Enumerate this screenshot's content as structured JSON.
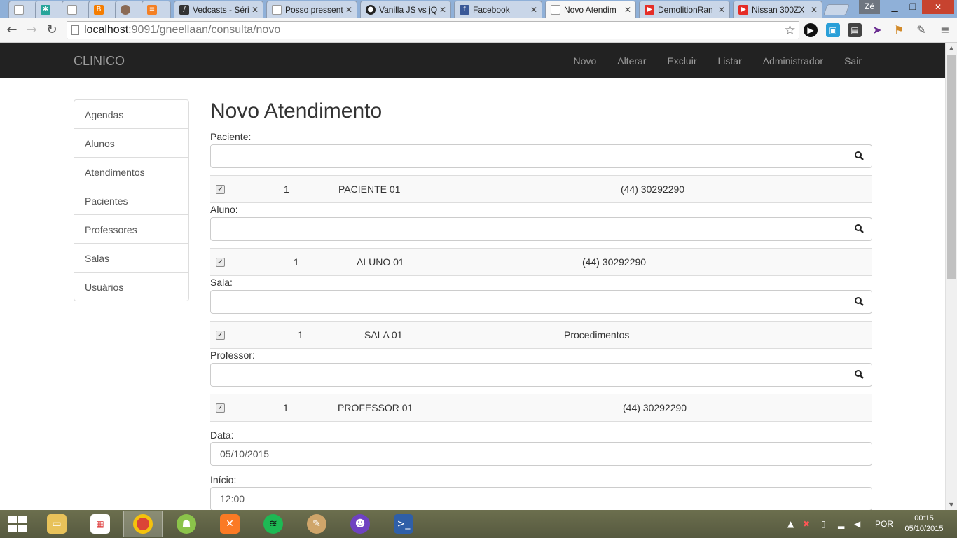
{
  "browser": {
    "tabs": [
      {
        "title": "",
        "icon": "doc"
      },
      {
        "title": "",
        "icon": "gear-green"
      },
      {
        "title": "",
        "icon": "doc"
      },
      {
        "title": "",
        "icon": "blogger"
      },
      {
        "title": "",
        "icon": "avatar"
      },
      {
        "title": "",
        "icon": "stackoverflow"
      },
      {
        "title": "Vedcasts - Séri",
        "icon": "vedcasts"
      },
      {
        "title": "Posso pressent",
        "icon": "doc"
      },
      {
        "title": "Vanilla JS vs jQ",
        "icon": "github"
      },
      {
        "title": "Facebook",
        "icon": "facebook"
      },
      {
        "title": "Novo Atendim",
        "icon": "doc",
        "active": true
      },
      {
        "title": "DemolitionRan",
        "icon": "youtube"
      },
      {
        "title": "Nissan 300ZX",
        "icon": "youtube"
      }
    ],
    "profile": "Zé",
    "url_host": "localhost",
    "url_rest": ":9091/gneellaan/consulta/novo"
  },
  "app": {
    "brand": "CLINICO",
    "nav": [
      "Novo",
      "Alterar",
      "Excluir",
      "Listar",
      "Administrador",
      "Sair"
    ],
    "sidebar": [
      "Agendas",
      "Alunos",
      "Atendimentos",
      "Pacientes",
      "Professores",
      "Salas",
      "Usuários"
    ],
    "title": "Novo Atendimento",
    "paciente": {
      "label": "Paciente:",
      "search_value": "",
      "row": {
        "checked": true,
        "id": "1",
        "name": "PACIENTE 01",
        "extra": "(44) 30292290"
      }
    },
    "aluno": {
      "label": "Aluno:",
      "search_value": "",
      "row": {
        "checked": true,
        "id": "1",
        "name": "ALUNO 01",
        "extra": "(44) 30292290"
      }
    },
    "sala": {
      "label": "Sala:",
      "search_value": "",
      "row": {
        "checked": true,
        "id": "1",
        "name": "SALA 01",
        "extra": "Procedimentos"
      }
    },
    "professor": {
      "label": "Professor:",
      "search_value": "",
      "row": {
        "checked": true,
        "id": "1",
        "name": "PROFESSOR 01",
        "extra": "(44) 30292290"
      }
    },
    "data": {
      "label": "Data:",
      "value": "05/10/2015"
    },
    "inicio": {
      "label": "Início:",
      "value": "12:00"
    }
  },
  "taskbar": {
    "language": "POR",
    "time": "00:15",
    "date": "05/10/2015"
  }
}
